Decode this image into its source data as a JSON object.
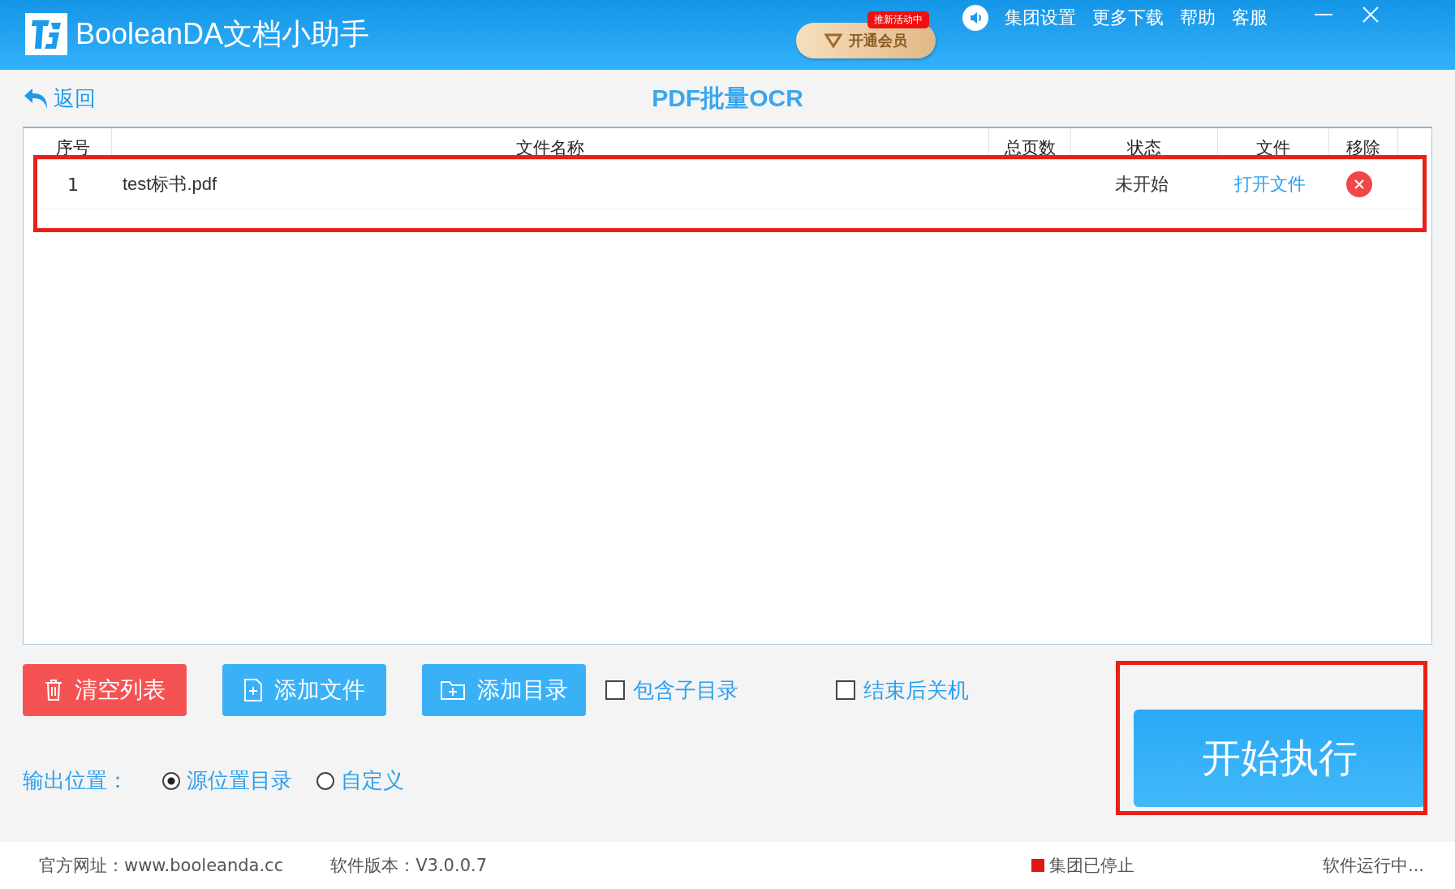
{
  "window": {
    "title": "BooleanDA文档小助手",
    "promo_badge": "推新活动中",
    "vip_button": "开通会员",
    "menu": [
      "集团设置",
      "更多下载",
      "帮助",
      "客服"
    ]
  },
  "nav": {
    "back": "返回",
    "page_title": "PDF批量OCR"
  },
  "table": {
    "columns": [
      "序号",
      "文件名称",
      "总页数",
      "状态",
      "文件",
      "移除"
    ],
    "rows": [
      {
        "index": "1",
        "name": "test标书.pdf",
        "status": "未开始",
        "open": "打开文件",
        "highlighted": true
      }
    ]
  },
  "actions": {
    "clear": "清空列表",
    "add_file": "添加文件",
    "add_dir": "添加目录",
    "options": [
      {
        "label": "包含子目录",
        "checked": false
      },
      {
        "label": "结束后关机",
        "checked": false
      }
    ],
    "start": {
      "label": "开始执行",
      "highlighted": true
    }
  },
  "output": {
    "label": "输出位置：",
    "options": [
      {
        "label": "源位置目录",
        "selected": true
      },
      {
        "label": "自定义",
        "selected": false
      }
    ]
  },
  "status_bar": {
    "website": "官方网址：www.booleanda.cc",
    "version": "软件版本：V3.0.0.7",
    "group_status": "集团已停止",
    "run_status": "软件运行中..."
  }
}
